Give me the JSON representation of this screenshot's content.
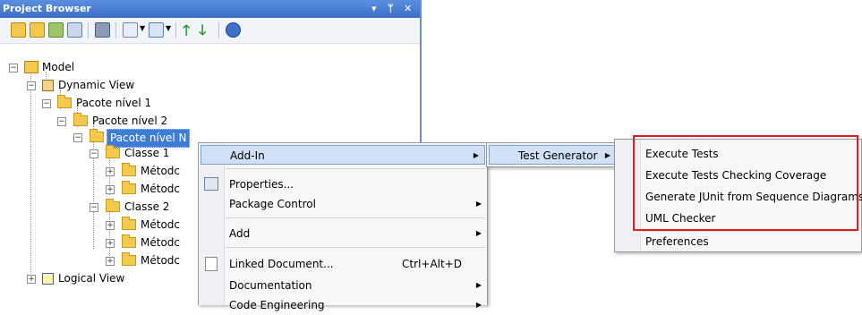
{
  "panel": {
    "title": "Project Browser",
    "controls": {
      "dropdown": "▾",
      "pin": "ᛘ",
      "close": "✕"
    }
  },
  "tree": {
    "model": "Model",
    "dynamic_view": "Dynamic View",
    "pacote1": "Pacote nível 1",
    "pacote2": "Pacote nível 2",
    "pacoteN": "Pacote nível N",
    "classe1": "Classe 1",
    "metodo": "Métodc",
    "classe2": "Classe 2",
    "logical_view": "Logical View"
  },
  "menu_main": {
    "add_in": "Add-In",
    "properties": "Properties...",
    "package_control": "Package Control",
    "add": "Add",
    "linked_document": "Linked Document...",
    "linked_shortcut": "Ctrl+Alt+D",
    "documentation": "Documentation",
    "code_engineering": "Code Engineering"
  },
  "menu_addin": {
    "test_generator": "Test Generator"
  },
  "menu_testgen": {
    "execute_tests": "Execute Tests",
    "execute_coverage": "Execute Tests Checking Coverage",
    "generate_junit": "Generate JUnit from Sequence Diagrams",
    "uml_checker": "UML Checker",
    "preferences": "Preferences"
  },
  "colors": {
    "title_bar": "#3b6fc4",
    "selection": "#3d7dd6",
    "menu_highlight": "#cfe0f7",
    "annotation_box": "#e02020"
  }
}
